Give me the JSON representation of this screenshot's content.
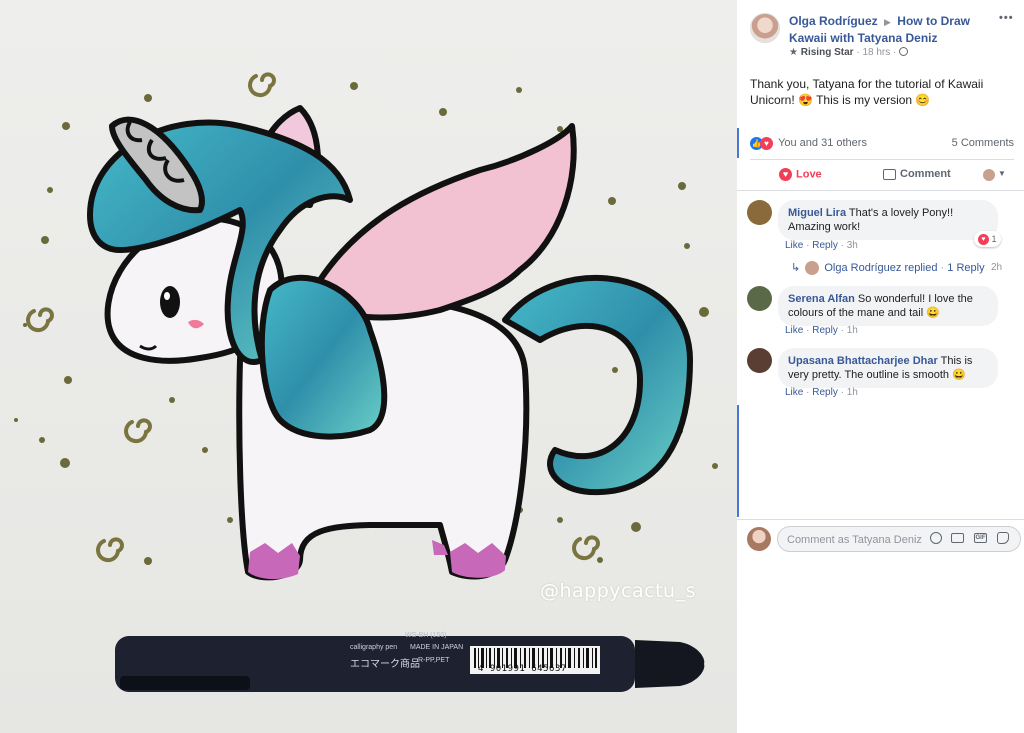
{
  "photo": {
    "watermark": "@happycactu_s",
    "pen_text": {
      "model": "WS-BH (150)",
      "line1": "calligraphy pen",
      "line2": "MADE IN JAPAN",
      "mark": "エコマーク商品",
      "mat": "R-PP,PET",
      "barcode": "4 901991 645637"
    }
  },
  "post": {
    "author": "Olga Rodríguez",
    "group": "How to Draw Kawaii with Tatyana Deniz",
    "badge": "Rising Star",
    "time": "18 hrs",
    "more_label": "•••",
    "text": "Thank you, Tatyana for the tutorial of Kawaii Unicorn! 😍 This is my version 😊",
    "reactions_summary": "You and 31 others",
    "comments_count": "5 Comments",
    "actions": {
      "love": "Love",
      "comment": "Comment"
    }
  },
  "comments": [
    {
      "author": "Miguel Lira",
      "text": "That's a lovely Pony!! Amazing work!",
      "like": "Like",
      "reply": "Reply",
      "time": "3h",
      "reaction_count": "1",
      "avatar_color": "#8a6a3a"
    },
    {
      "author": "Serena Alfan",
      "text": "So wonderful! I love the colours of the mane and tail 😀",
      "like": "Like",
      "reply": "Reply",
      "time": "1h",
      "avatar_color": "#5a6a48"
    },
    {
      "author": "Upasana Bhattacharjee Dhar",
      "text": "This is very pretty. The outline is smooth 😀",
      "like": "Like",
      "reply": "Reply",
      "time": "1h",
      "avatar_color": "#5a3e34"
    }
  ],
  "reply_summary": {
    "author": "Olga Rodríguez",
    "verb": "replied",
    "dot": "·",
    "count": "1 Reply",
    "time": "2h"
  },
  "composer": {
    "placeholder": "Comment as Tatyana Deniz"
  },
  "colors": {
    "link": "#385898",
    "love": "#f33e58",
    "bubble": "#f2f3f5",
    "divider": "#dadde1"
  }
}
